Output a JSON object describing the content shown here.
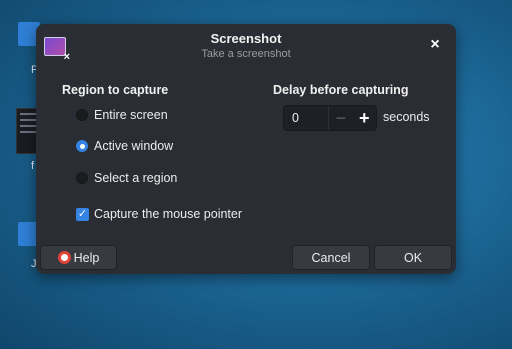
{
  "desktop": {
    "label_1": "F",
    "label_2": "f",
    "label_3": "J"
  },
  "dialog": {
    "title": "Screenshot",
    "subtitle": "Take a screenshot",
    "close_glyph": "×",
    "region": {
      "heading": "Region to capture",
      "options": [
        {
          "label": "Entire screen",
          "selected": false
        },
        {
          "label": "Active window",
          "selected": true
        },
        {
          "label": "Select a region",
          "selected": false
        }
      ],
      "mouse_pointer_label": "Capture the mouse pointer",
      "mouse_pointer_checked": true
    },
    "delay": {
      "heading": "Delay before capturing",
      "value": "0",
      "minus_glyph": "−",
      "plus_glyph": "+",
      "unit": "seconds"
    },
    "buttons": {
      "help": "Help",
      "cancel": "Cancel",
      "ok": "OK"
    }
  },
  "colors": {
    "accent": "#3584e4",
    "dialog_bg": "#2b2d34",
    "help_icon": "#e0433a"
  }
}
